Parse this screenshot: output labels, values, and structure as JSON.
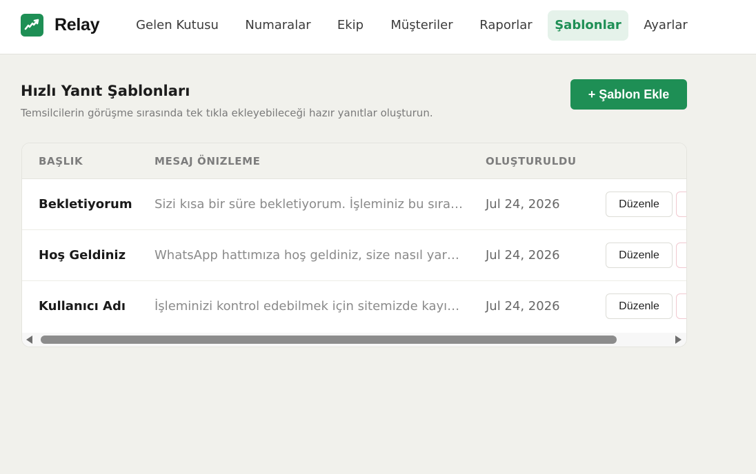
{
  "app": {
    "brand": "Relay",
    "accent": "#1e8f55"
  },
  "nav": {
    "items": [
      {
        "label": "Gelen Kutusu"
      },
      {
        "label": "Numaralar"
      },
      {
        "label": "Ekip"
      },
      {
        "label": "Müşteriler"
      },
      {
        "label": "Raporlar"
      },
      {
        "label": "Şablonlar",
        "active": true
      },
      {
        "label": "Ayarlar"
      }
    ]
  },
  "page": {
    "title": "Hızlı Yanıt Şablonları",
    "subtitle": "Temsilcilerin görüşme sırasında tek tıkla ekleyebileceği hazır yanıtlar oluşturun.",
    "add_button": "+ Şablon Ekle"
  },
  "table": {
    "columns": [
      "BAŞLIK",
      "MESAJ ÖNIZLEME",
      "OLUŞTURULDU"
    ],
    "edit_label": "Düzenle",
    "rows": [
      {
        "title": "Bekletiyorum",
        "preview": "Sizi kısa bir süre bekletiyorum. İşleminiz bu sıra…",
        "created": "Jul 24, 2026"
      },
      {
        "title": "Hoş Geldiniz",
        "preview": "WhatsApp hattımıza hoş geldiniz, size nasıl yar…",
        "created": "Jul 24, 2026"
      },
      {
        "title": "Kullanıcı Adı",
        "preview": "İşleminizi kontrol edebilmek için sitemizde kayı…",
        "created": "Jul 24, 2026"
      }
    ]
  }
}
